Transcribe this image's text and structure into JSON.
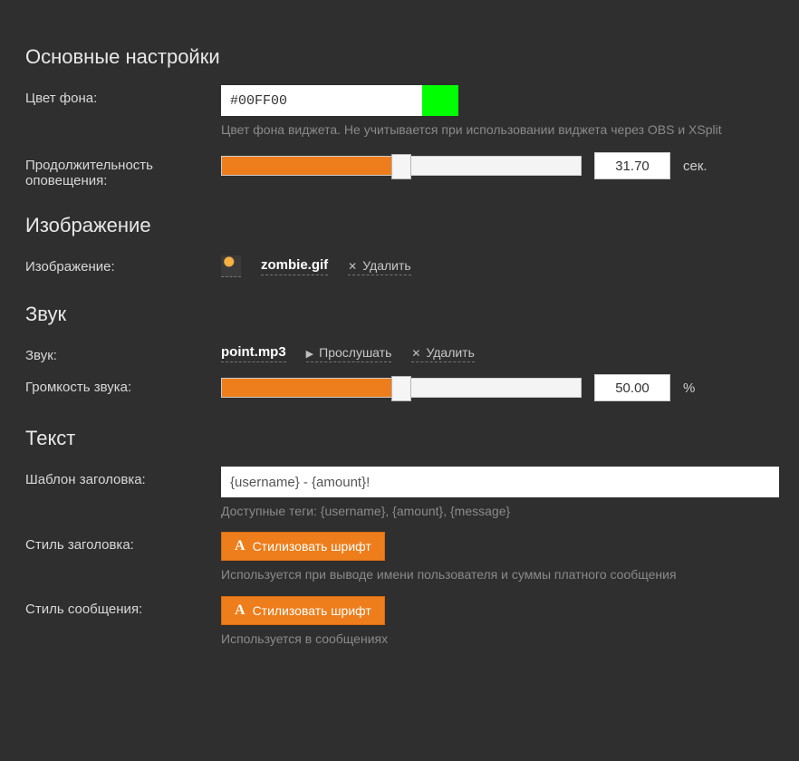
{
  "sections": {
    "basic": {
      "title": "Основные настройки",
      "bgcolor_label": "Цвет фона:",
      "bgcolor_value": "#00FF00",
      "bgcolor_hint": "Цвет фона виджета. Не учитывается при использовании виджета через OBS и XSplit",
      "duration_label": "Продолжительность оповещения:",
      "duration_value": "31.70",
      "duration_percent": 50,
      "duration_unit": "сек."
    },
    "image": {
      "title": "Изображение",
      "label": "Изображение:",
      "filename": "zombie.gif",
      "delete_label": "Удалить"
    },
    "sound": {
      "title": "Звук",
      "label": "Звук:",
      "filename": "point.mp3",
      "preview_label": "Прослушать",
      "delete_label": "Удалить",
      "volume_label": "Громкость звука:",
      "volume_value": "50.00",
      "volume_percent": 50,
      "volume_unit": "%"
    },
    "text": {
      "title": "Текст",
      "header_template_label": "Шаблон заголовка:",
      "header_template_value": "{username} - {amount}!",
      "header_template_hint": "Доступные теги: {username}, {amount}, {message}",
      "header_style_label": "Стиль заголовка:",
      "header_style_btn": "Стилизовать шрифт",
      "header_style_hint": "Используется при выводе имени пользователя и суммы платного сообщения",
      "message_style_label": "Стиль сообщения:",
      "message_style_btn": "Стилизовать шрифт",
      "message_style_hint": "Используется в сообщениях"
    }
  },
  "colors": {
    "accent": "#ee7d1b",
    "swatch": "#00ff00"
  }
}
